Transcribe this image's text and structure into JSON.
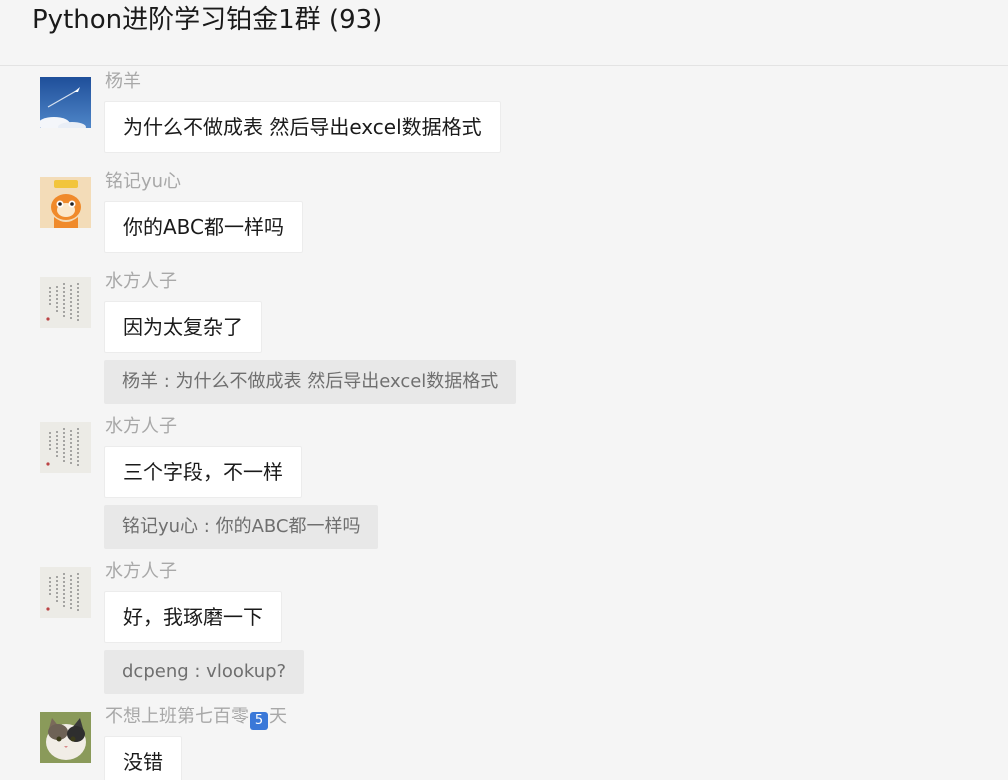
{
  "header": {
    "title": "Python进阶学习铂金1群 (93)"
  },
  "messages": [
    {
      "sender": "杨羊",
      "text": "为什么不做成表 然后导出excel数据格式",
      "avatar": "airplane-sky-avatar"
    },
    {
      "sender": "铭记yu心",
      "text": "你的ABC都一样吗",
      "avatar": "cartoon-tiger-avatar"
    },
    {
      "sender": "水方人子",
      "text": "因为太复杂了",
      "quote": "杨羊 : 为什么不做成表 然后导出excel数据格式",
      "avatar": "calligraphy-avatar"
    },
    {
      "sender": "水方人子",
      "text": "三个字段，不一样",
      "quote": "铭记yu心 : 你的ABC都一样吗",
      "avatar": "calligraphy-avatar"
    },
    {
      "sender": "水方人子",
      "text": "好，我琢磨一下",
      "quote": "dcpeng : vlookup?",
      "avatar": "calligraphy-avatar"
    },
    {
      "sender": "不想上班第七百零",
      "sender_badge": "5",
      "sender_suffix": "天",
      "text": "没错",
      "avatar": "cat-avatar"
    }
  ],
  "colors": {
    "background": "#f5f5f5",
    "bubble": "#ffffff",
    "quote": "#e8e8e8",
    "sender_text": "#a8a8a8",
    "badge": "#3a78d8"
  }
}
